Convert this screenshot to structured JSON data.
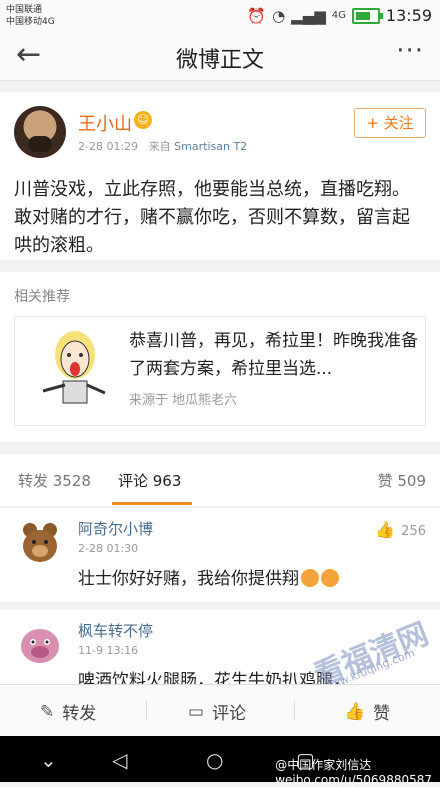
{
  "status": {
    "carrier1": "中国联通",
    "carrier2": "中国移动4G",
    "time": "13:59",
    "network": "4G"
  },
  "nav": {
    "title": "微博正文"
  },
  "post": {
    "author": "王小山",
    "meta_time": "2-28 01:29",
    "meta_from": "来自",
    "meta_device": "Smartisan T2",
    "follow": "+ 关注",
    "text": "川普没戏，立此存照，他要能当总统，直播吃翔。敢对赌的才行，赌不赢你吃，否则不算数，留言起哄的滚粗。"
  },
  "related": {
    "title": "相关推荐",
    "card_text": "恭喜川普，再见，希拉里！昨晚我准备了两套方案，希拉里当选...",
    "card_source": "来源于 地瓜熊老六"
  },
  "tabs": {
    "repost": "转发 3528",
    "comment": "评论 963",
    "like": "赞 509"
  },
  "comments": [
    {
      "name": "阿奇尔小博",
      "time": "2-28 01:30",
      "text": "壮士你好好赌，我给你提供翔",
      "likes": "256"
    },
    {
      "name": "枫车转不停",
      "time": "11-9 13:16",
      "text": "啤酒饮料火腿肠，花生牛奶扒鸡腿，"
    }
  ],
  "watermark": {
    "site": "看福清网",
    "url": "www.kfuqing.com"
  },
  "toolbar": {
    "repost": "转发",
    "comment": "评论",
    "like": "赞"
  },
  "footer_watermark": "weibo.com/u/5069880587",
  "footer_watermark2": "@中国作家刘信达"
}
